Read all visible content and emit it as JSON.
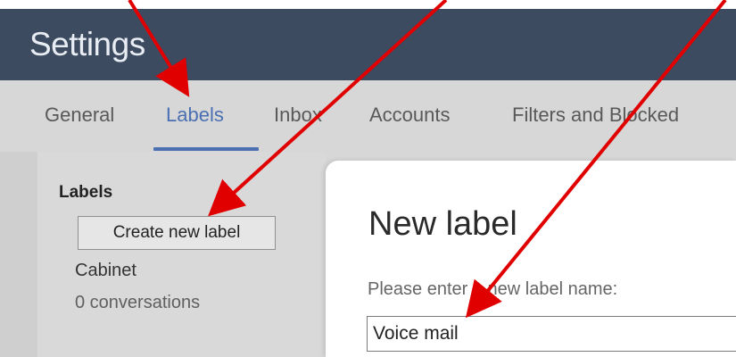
{
  "header": {
    "title": "Settings"
  },
  "tabs": [
    {
      "label": "General",
      "active": false
    },
    {
      "label": "Labels",
      "active": true
    },
    {
      "label": "Inbox",
      "active": false
    },
    {
      "label": "Accounts",
      "active": false
    },
    {
      "label": "Filters and Blocked",
      "active": false
    }
  ],
  "labels_panel": {
    "heading": "Labels",
    "create_button": "Create new label",
    "items": [
      {
        "name": "Cabinet",
        "count": "0 conversations"
      }
    ]
  },
  "dialog": {
    "title": "New label",
    "prompt": "Please enter a new label name:",
    "input_value": "Voice mail"
  },
  "colors": {
    "header_bg": "#3d4b61",
    "active_tab": "#4a6fb2",
    "annotation_arrow": "#e00000"
  },
  "annotations": {
    "arrows": [
      "arrow-to-labels-tab",
      "arrow-to-create-new-label-button",
      "arrow-to-label-name-input"
    ]
  }
}
